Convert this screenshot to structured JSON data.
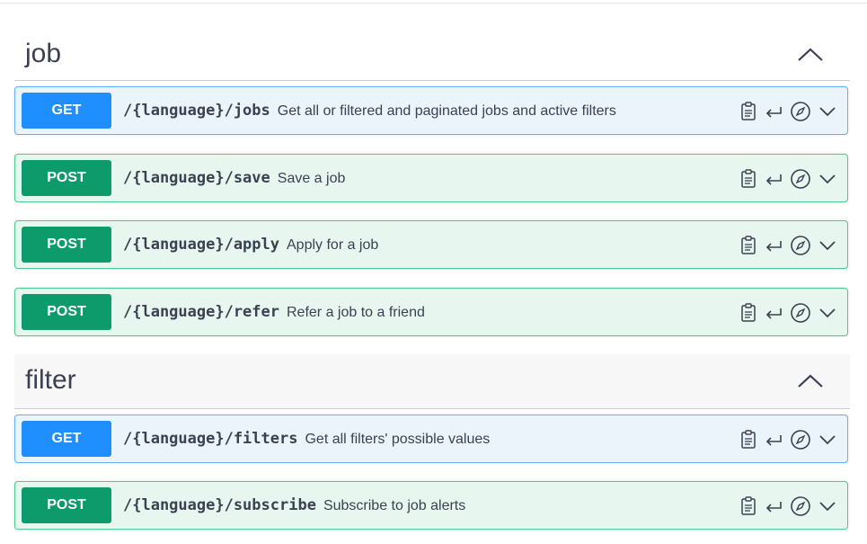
{
  "sections": [
    {
      "title": "job",
      "operations": [
        {
          "method": "GET",
          "path": "/{language}/jobs",
          "description": "Get all or filtered and paginated jobs and active filters"
        },
        {
          "method": "POST",
          "path": "/{language}/save",
          "description": "Save a job"
        },
        {
          "method": "POST",
          "path": "/{language}/apply",
          "description": "Apply for a job"
        },
        {
          "method": "POST",
          "path": "/{language}/refer",
          "description": "Refer a job to a friend"
        }
      ]
    },
    {
      "title": "filter",
      "operations": [
        {
          "method": "GET",
          "path": "/{language}/filters",
          "description": "Get all filters' possible values"
        },
        {
          "method": "POST",
          "path": "/{language}/subscribe",
          "description": "Subscribe to job alerts"
        }
      ]
    }
  ],
  "icons": {
    "copy": "clipboard-icon",
    "back": "return-arrow-icon",
    "explore": "compass-icon",
    "expand": "chevron-down-icon",
    "collapse": "chevron-up-icon"
  },
  "colors": {
    "get_method": "#1f8fff",
    "post_method": "#0d9b6c",
    "get_bg": "#ebf3fb",
    "post_bg": "#e8f6f0",
    "get_border": "#61affe",
    "post_border": "#49cc90"
  }
}
